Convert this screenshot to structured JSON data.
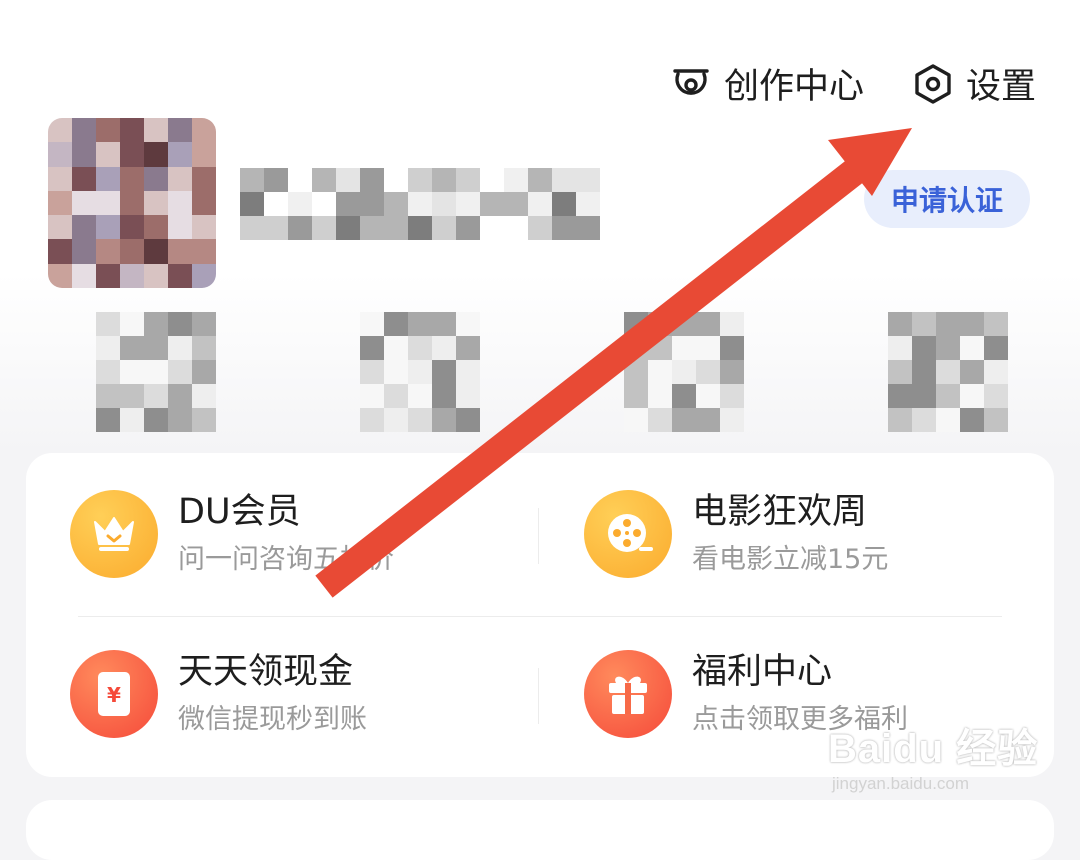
{
  "header": {
    "creator_center_label": "创作中心",
    "settings_label": "设置"
  },
  "profile": {
    "verify_label": "申请认证"
  },
  "services": [
    {
      "title": "DU会员",
      "subtitle": "问一问咨询五折价",
      "icon": "crown-icon",
      "color": "#fbb035"
    },
    {
      "title": "电影狂欢周",
      "subtitle": "看电影立减15元",
      "icon": "film-reel-icon",
      "color": "#fbb035"
    },
    {
      "title": "天天领现金",
      "subtitle": "微信提现秒到账",
      "icon": "red-envelope-icon",
      "color": "#fa5b3c"
    },
    {
      "title": "福利中心",
      "subtitle": "点击领取更多福利",
      "icon": "gift-icon",
      "color": "#fa5b3c"
    }
  ],
  "watermark": {
    "logo": "Baidu 经验",
    "url": "jingyan.baidu.com"
  },
  "colors": {
    "accent_blue": "#3a62d8",
    "annotation_arrow": "#e84a35"
  }
}
